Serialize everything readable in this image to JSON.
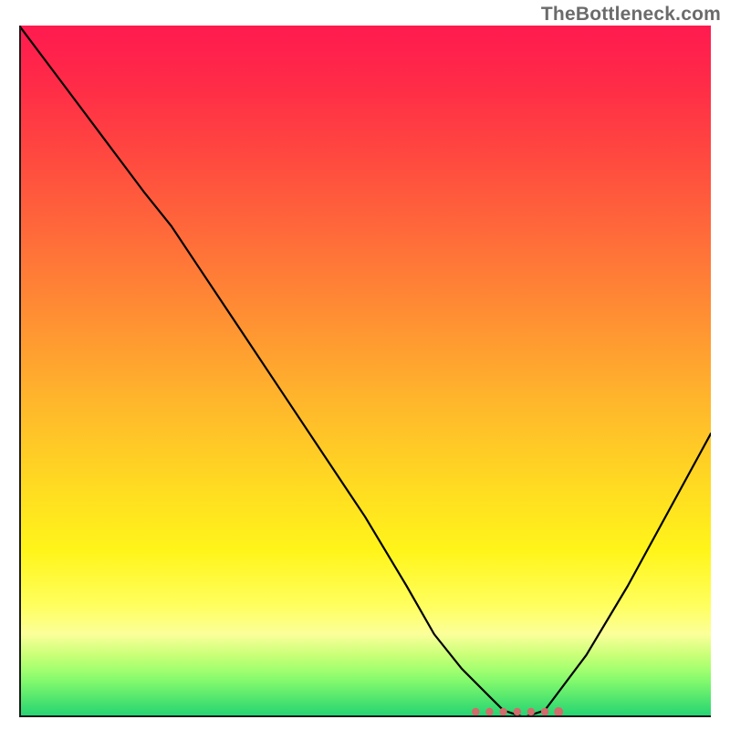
{
  "watermark": "TheBottleneck.com",
  "colors": {
    "curve": "#000000",
    "marker": "#d26b6b",
    "axis": "#1a1a1a"
  },
  "chart_data": {
    "type": "line",
    "title": "",
    "xlabel": "",
    "ylabel": "",
    "xlim": [
      0,
      100
    ],
    "ylim": [
      0,
      100
    ],
    "series": [
      {
        "name": "bottleneck_curve",
        "x": [
          0,
          6,
          12,
          18,
          22,
          26,
          32,
          38,
          44,
          50,
          56,
          60,
          64,
          68,
          70,
          73,
          76,
          82,
          88,
          94,
          100
        ],
        "values": [
          100,
          92,
          84,
          76,
          71,
          65,
          56,
          47,
          38,
          29,
          19,
          12,
          7,
          3,
          1,
          0,
          1,
          9,
          19,
          30,
          41
        ]
      }
    ],
    "minimum_marker": {
      "x_start": 66,
      "x_end": 78,
      "y": 0,
      "dot_count": 7
    },
    "background_gradient_description": "vertical gradient red→orange→yellow→green representing bottleneck severity (top=high, bottom=low)"
  }
}
